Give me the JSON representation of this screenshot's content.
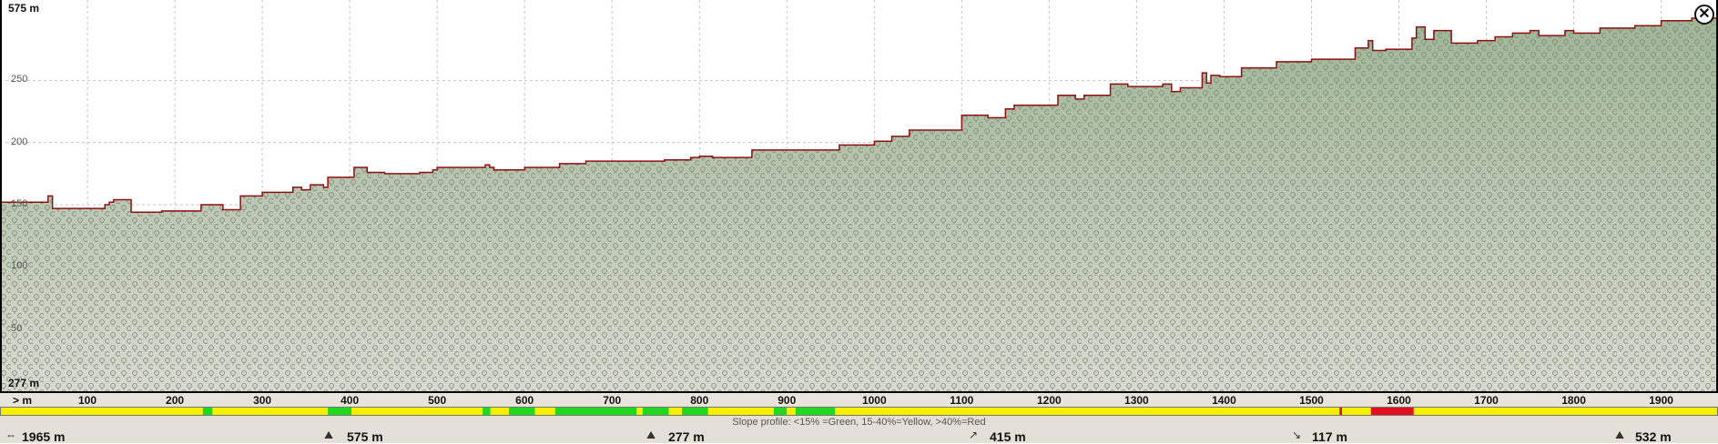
{
  "header": {
    "close_icon": "close-icon"
  },
  "chart_data": {
    "type": "area",
    "title": "",
    "xlabel": "",
    "ylabel": "",
    "x_unit_label": "> m",
    "max_label": "575 m",
    "min_label": "277 m",
    "xlim": [
      0,
      1965
    ],
    "ylim": [
      0,
      300
    ],
    "x_ticks": [
      "100",
      "200",
      "300",
      "400",
      "500",
      "600",
      "700",
      "800",
      "900",
      "1000",
      "1100",
      "1200",
      "1300",
      "1400",
      "1500",
      "1600",
      "1700",
      "1800",
      "1900"
    ],
    "y_ticks": [
      "250",
      "200",
      "150",
      "100",
      "50"
    ],
    "grid": true,
    "fill_color": "#a8bca0",
    "line_color": "#8b1010",
    "x": [
      0,
      50,
      55,
      60,
      85,
      120,
      125,
      130,
      150,
      185,
      230,
      255,
      275,
      300,
      335,
      345,
      355,
      370,
      375,
      400,
      405,
      420,
      440,
      480,
      495,
      500,
      520,
      555,
      560,
      565,
      600,
      640,
      670,
      700,
      760,
      790,
      800,
      815,
      835,
      860,
      880,
      920,
      960,
      1000,
      1020,
      1040,
      1100,
      1130,
      1150,
      1160,
      1210,
      1230,
      1240,
      1270,
      1290,
      1330,
      1340,
      1350,
      1375,
      1380,
      1385,
      1395,
      1420,
      1460,
      1500,
      1550,
      1565,
      1570,
      1585,
      1615,
      1620,
      1630,
      1640,
      1660,
      1690,
      1710,
      1730,
      1750,
      1760,
      1790,
      1800,
      1830,
      1870,
      1900,
      1935,
      1965
    ],
    "values": [
      152,
      152,
      157,
      147,
      147,
      150,
      152,
      154,
      144,
      145,
      150,
      146,
      157,
      160,
      164,
      162,
      166,
      164,
      172,
      172,
      180,
      176,
      175,
      176,
      178,
      180,
      180,
      182,
      180,
      178,
      180,
      183,
      185,
      185,
      186,
      188,
      189,
      188,
      188,
      194,
      194,
      194,
      198,
      201,
      205,
      210,
      222,
      220,
      227,
      230,
      238,
      235,
      238,
      247,
      245,
      247,
      241,
      244,
      256,
      248,
      254,
      253,
      260,
      265,
      267,
      276,
      282,
      274,
      275,
      284,
      293,
      283,
      290,
      280,
      282,
      285,
      288,
      290,
      286,
      290,
      288,
      292,
      294,
      298,
      300,
      300
    ]
  },
  "slope_legend": {
    "caption": "Slope profile: <15% =Green, 15-40%=Yellow, >40%=Red",
    "colors": {
      "green": "#1fd81f",
      "yellow": "#f4ef00",
      "red": "#e01020"
    },
    "segments": [
      {
        "from": 0,
        "to": 232,
        "color": "yellow"
      },
      {
        "from": 232,
        "to": 243,
        "color": "green"
      },
      {
        "from": 243,
        "to": 375,
        "color": "yellow"
      },
      {
        "from": 375,
        "to": 402,
        "color": "green"
      },
      {
        "from": 402,
        "to": 552,
        "color": "yellow"
      },
      {
        "from": 552,
        "to": 561,
        "color": "green"
      },
      {
        "from": 561,
        "to": 582,
        "color": "yellow"
      },
      {
        "from": 582,
        "to": 612,
        "color": "green"
      },
      {
        "from": 612,
        "to": 635,
        "color": "yellow"
      },
      {
        "from": 635,
        "to": 728,
        "color": "green"
      },
      {
        "from": 728,
        "to": 735,
        "color": "yellow"
      },
      {
        "from": 735,
        "to": 765,
        "color": "green"
      },
      {
        "from": 765,
        "to": 780,
        "color": "yellow"
      },
      {
        "from": 780,
        "to": 810,
        "color": "green"
      },
      {
        "from": 810,
        "to": 885,
        "color": "yellow"
      },
      {
        "from": 885,
        "to": 900,
        "color": "green"
      },
      {
        "from": 900,
        "to": 910,
        "color": "yellow"
      },
      {
        "from": 910,
        "to": 955,
        "color": "green"
      },
      {
        "from": 955,
        "to": 1532,
        "color": "yellow"
      },
      {
        "from": 1532,
        "to": 1535,
        "color": "red"
      },
      {
        "from": 1535,
        "to": 1568,
        "color": "yellow"
      },
      {
        "from": 1568,
        "to": 1617,
        "color": "red"
      },
      {
        "from": 1617,
        "to": 1965,
        "color": "yellow"
      }
    ]
  },
  "footer": {
    "distance": "1965 m",
    "max_elevation": "575 m",
    "min_elevation": "277 m",
    "ascent": "415 m",
    "descent": "117 m",
    "end_elevation": "532 m",
    "distance_icon": "distance-icon",
    "max_icon": "mountain-max-icon",
    "min_icon": "mountain-min-icon",
    "ascent_icon": "ascent-icon",
    "descent_icon": "descent-icon",
    "end_icon": "end-elevation-icon"
  }
}
